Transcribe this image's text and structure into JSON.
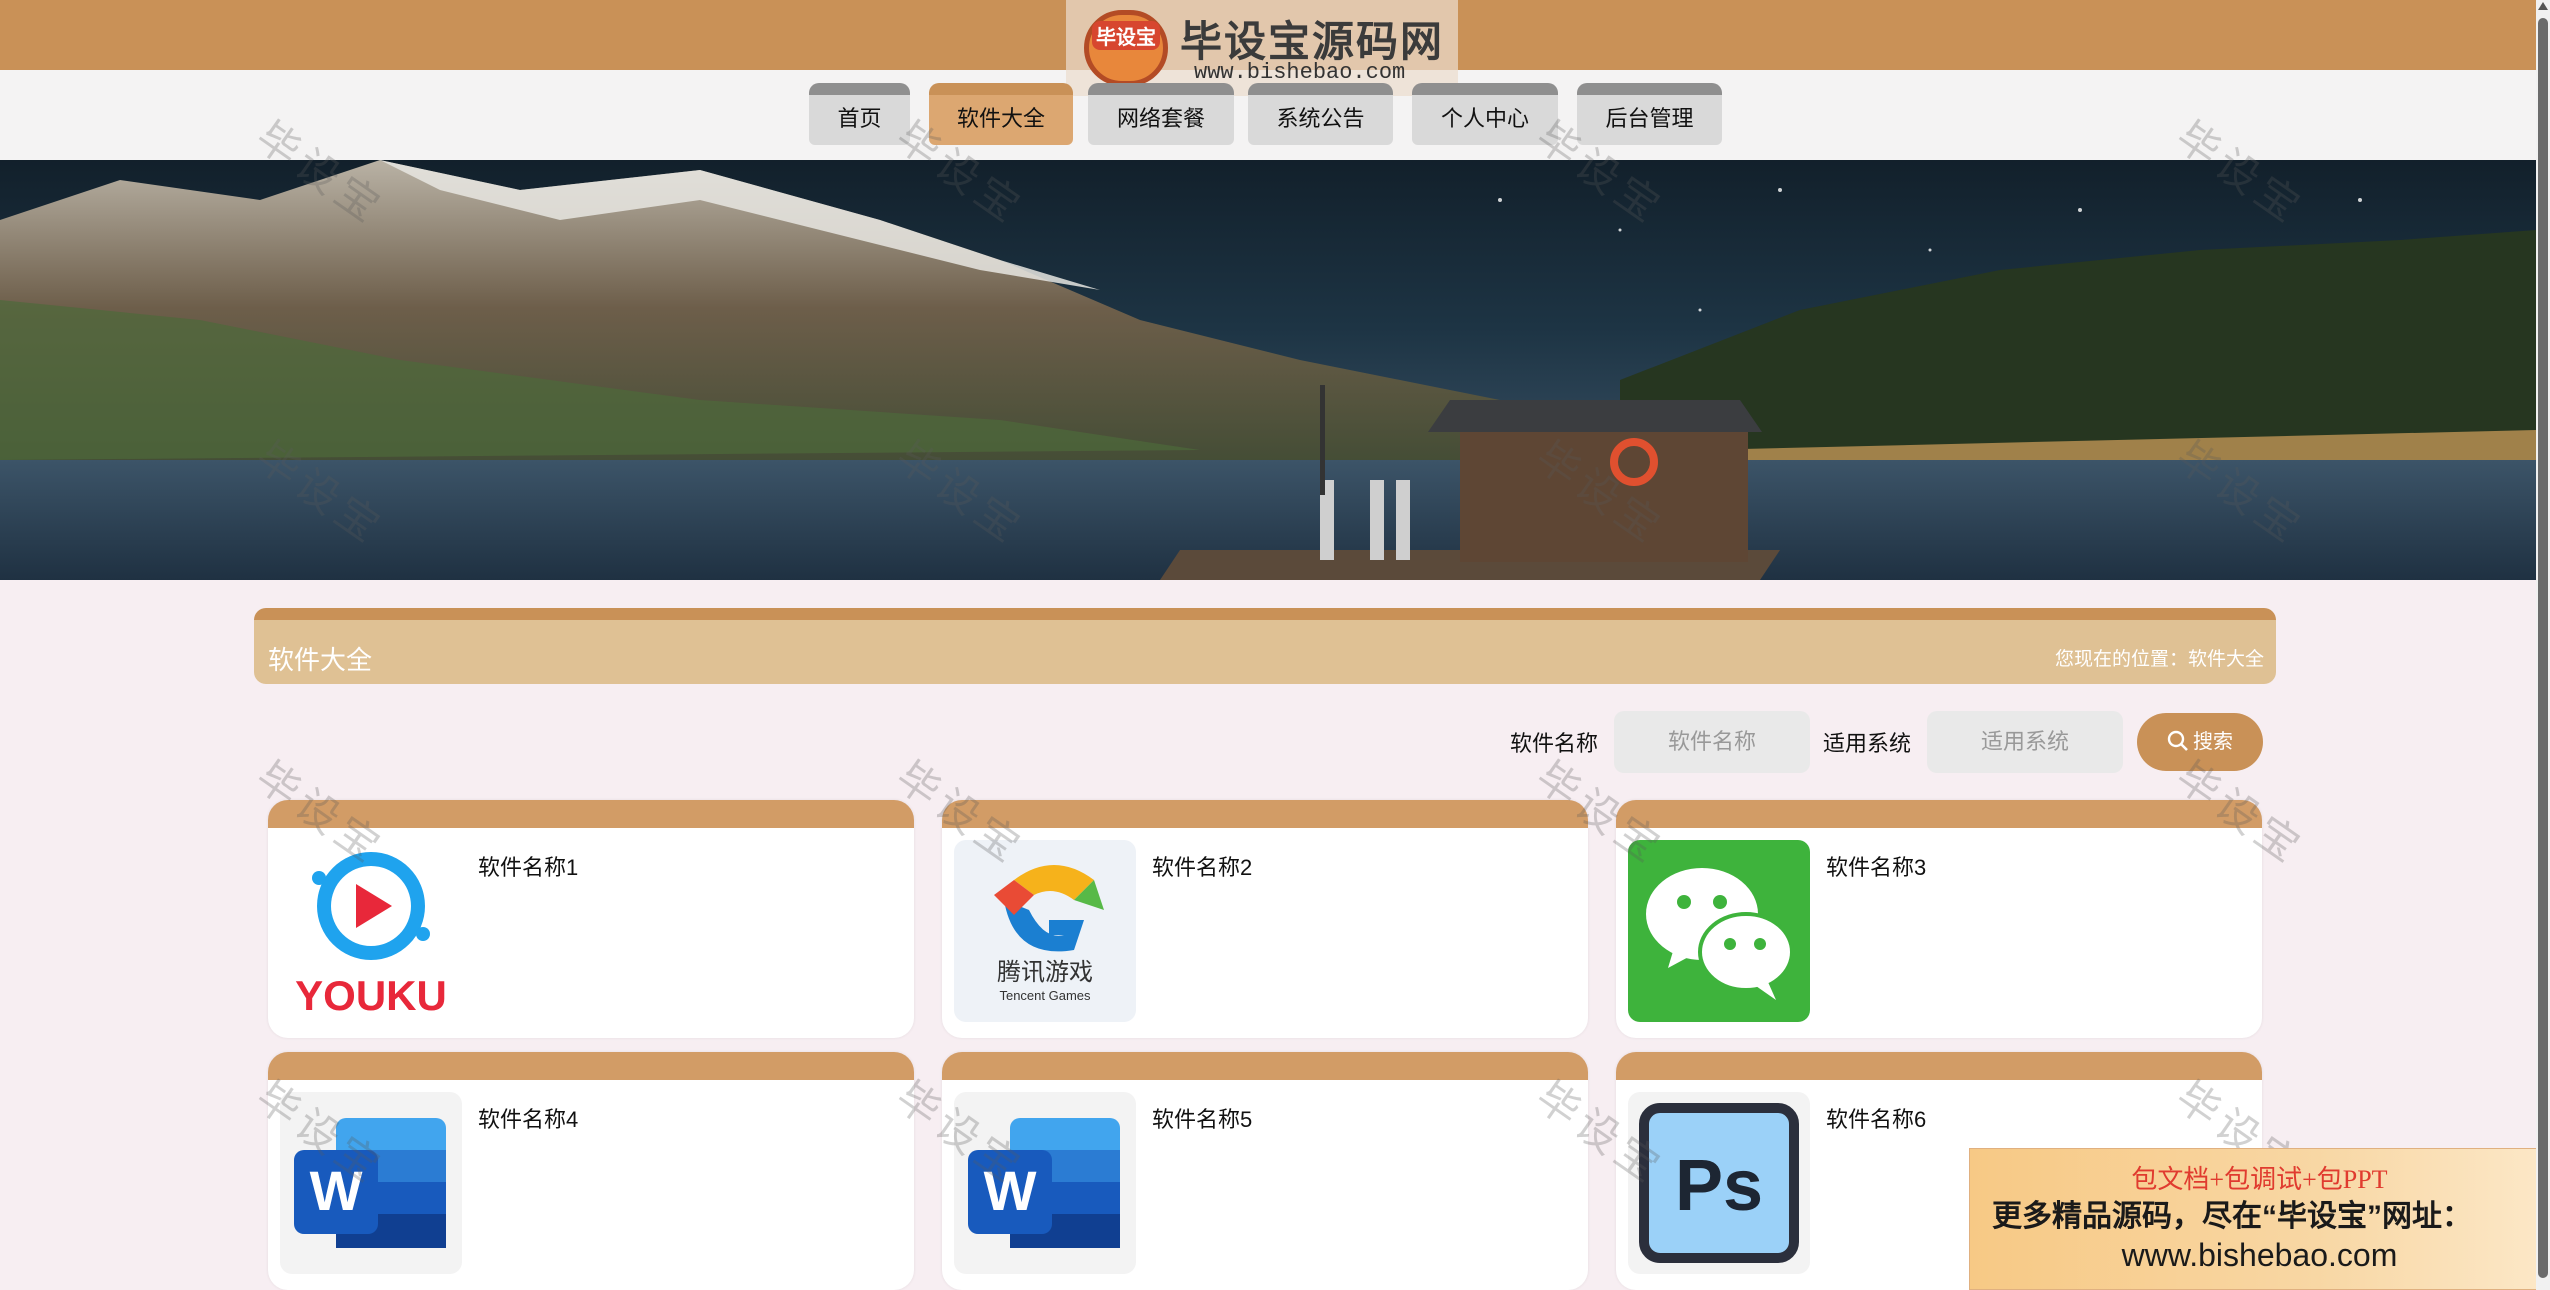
{
  "logo": {
    "badge": "毕设宝",
    "name": "毕设宝源码网",
    "url": "www.bishebao.com"
  },
  "nav": {
    "items": [
      "首页",
      "软件大全",
      "网络套餐",
      "系统公告",
      "个人中心",
      "后台管理"
    ],
    "active": "软件大全"
  },
  "section": {
    "title": "软件大全",
    "location": "您现在的位置：软件大全"
  },
  "search": {
    "name_label": "软件名称",
    "name_placeholder": "软件名称",
    "system_label": "适用系统",
    "system_placeholder": "适用系统",
    "button_label": "搜索"
  },
  "products": [
    {
      "name": "软件名称1",
      "icon": "youku-logo-icon"
    },
    {
      "name": "软件名称2",
      "icon": "tencent-games-logo-icon"
    },
    {
      "name": "软件名称3",
      "icon": "wechat-logo-icon"
    },
    {
      "name": "软件名称4",
      "icon": "word-logo-icon"
    },
    {
      "name": "软件名称5",
      "icon": "word-logo-icon"
    },
    {
      "name": "软件名称6",
      "icon": "photoshop-logo-icon"
    }
  ],
  "watermark": "毕设宝",
  "ad": {
    "line1": "包文档+包调试+包PPT",
    "line2": "更多精品源码，尽在“毕设宝”网址：",
    "line3": "www.bishebao.com"
  },
  "colors": {
    "accent": "#c99157",
    "nav_active": "#dca771",
    "crumb_bg": "#dfc194",
    "page_bg": "#f7eef2"
  }
}
